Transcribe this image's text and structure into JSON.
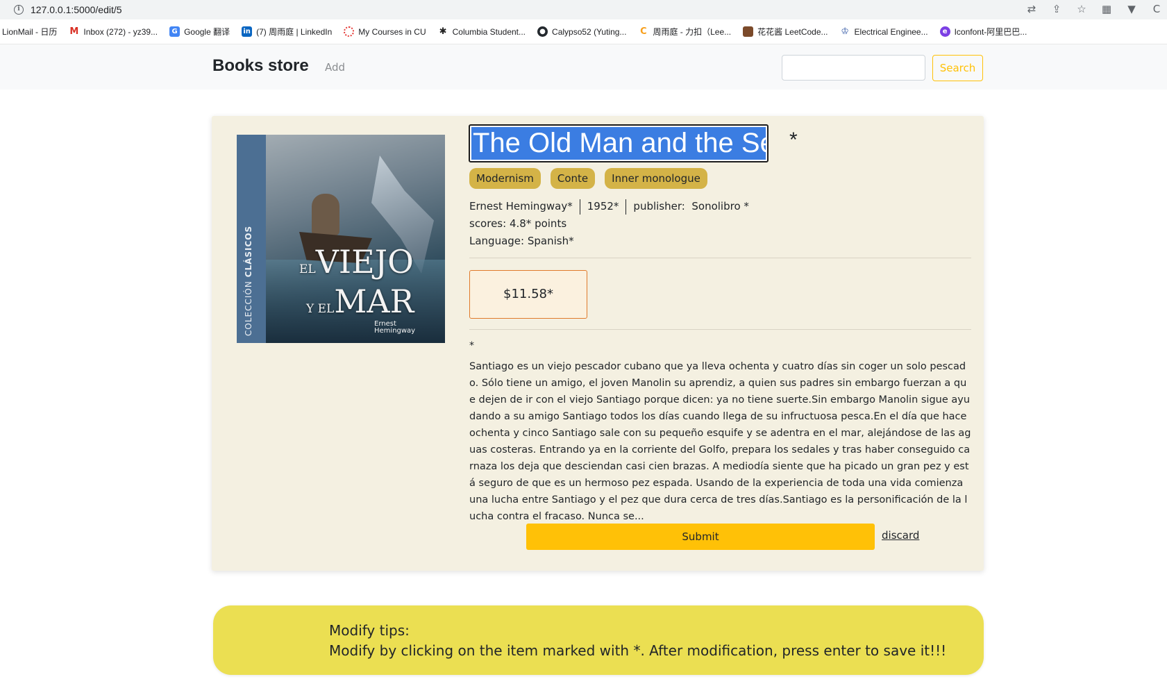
{
  "browser": {
    "url": "127.0.0.1:5000/edit/5",
    "bookmarks": [
      {
        "label": "LionMail - 日历",
        "icon": "none",
        "color": ""
      },
      {
        "label": "Inbox (272) - yz39...",
        "icon": "gmail-icon",
        "color": "#d93025"
      },
      {
        "label": "Google 翻译",
        "icon": "google-translate-icon",
        "color": "#4285f4"
      },
      {
        "label": "(7) 周雨庭 | LinkedIn",
        "icon": "linkedin-icon",
        "color": "#0a66c2"
      },
      {
        "label": "My Courses in CU",
        "icon": "courses-icon",
        "color": "#e53935"
      },
      {
        "label": "Columbia Student...",
        "icon": "columbia-icon",
        "color": "#222222"
      },
      {
        "label": "Calypso52 (Yuting...",
        "icon": "github-icon",
        "color": "#24292e"
      },
      {
        "label": "周雨庭 - 力扣（Lee...",
        "icon": "leetcode-icon",
        "color": "#333333"
      },
      {
        "label": "花花酱 LeetCode...",
        "icon": "leetcode-avatar-icon",
        "color": "#7b4a2a"
      },
      {
        "label": "Electrical Enginee...",
        "icon": "crown-icon",
        "color": "#3a5ea8"
      },
      {
        "label": "Iconfont-阿里巴巴...",
        "icon": "iconfont-icon",
        "color": "#7b3fe4"
      }
    ]
  },
  "navbar": {
    "brand": "Books store",
    "add_label": "Add",
    "search_placeholder": "",
    "search_label": "Search"
  },
  "book": {
    "cover": {
      "band_prefix": "COLECCIÓN",
      "band_highlight": "CLÁSICOS",
      "title_el": "EL",
      "title_viejo": "VIEJO",
      "title_yel": "Y EL",
      "title_mar": "MAR",
      "author": "Ernest Hemingway"
    },
    "title": "The Old Man and the Sea",
    "title_marker": "*",
    "tags": [
      "Modernism",
      "Conte",
      "Inner monologue"
    ],
    "author": "Ernest Hemingway*",
    "year": "1952*",
    "publisher_label": "publisher:",
    "publisher": "Sonolibro *",
    "scores": "scores: 4.8* points",
    "language": "Language: Spanish*",
    "price": "$11.58*",
    "description_marker": "*",
    "description": "Santiago es un viejo pescador cubano que ya lleva ochenta y cuatro días sin coger un solo pescado. Sólo tiene un amigo, el joven Manolin su aprendiz, a quien sus padres sin embargo fuerzan a que dejen de ir con el viejo Santiago porque dicen: ya no tiene suerte.Sin embargo Manolin sigue ayudando a su amigo Santiago todos los días cuando llega de su infructuosa pesca.En el día que hace ochenta y cinco Santiago sale con su pequeño esquife y se adentra en el mar, alejándose de las aguas costeras. Entrando ya en la corriente del Golfo, prepara los sedales y tras haber conseguido carnaza los deja que desciendan casi cien brazas. A mediodía siente que ha picado un gran pez y está seguro de que es un hermoso pez espada. Usando de la experiencia de toda una vida comienza una lucha entre Santiago y el pez que dura cerca de tres días.Santiago es la personificación de la lucha contra el fracaso. Nunca se...",
    "submit_label": "Submit",
    "discard_label": "discard"
  },
  "tips": {
    "heading": "Modify tips:",
    "body": "Modify by clicking on the item marked with *. After modification, press enter to save it!!!"
  },
  "colors": {
    "accent": "#ffc107",
    "tag": "#d4b347",
    "card_bg": "#f4f0e1",
    "tips_bg": "#ebdf52",
    "selection": "#3b7de2"
  }
}
